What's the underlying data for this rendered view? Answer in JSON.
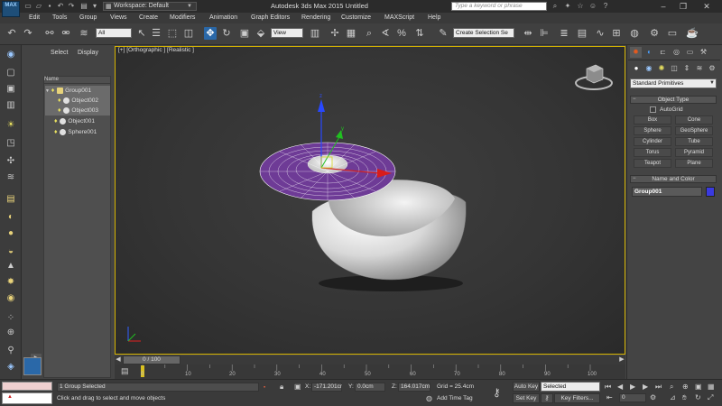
{
  "app": {
    "logo": "MAX",
    "window_title": "Autodesk 3ds Max 2015    Untitled",
    "workspace": "Workspace: Default",
    "search_placeholder": "Type a keyword or phrase"
  },
  "menu": [
    "Edit",
    "Tools",
    "Group",
    "Views",
    "Create",
    "Modifiers",
    "Animation",
    "Graph Editors",
    "Rendering",
    "Customize",
    "MAXScript",
    "Help"
  ],
  "toolbar": {
    "selection_filter": "All",
    "ref_coord": "View",
    "named_selection": "Create Selection Se"
  },
  "scene_explorer": {
    "tabs": [
      "Select",
      "Display"
    ],
    "column_header": "Name",
    "items": [
      {
        "name": "Group001",
        "level": 0,
        "selected": true
      },
      {
        "name": "Object002",
        "level": 1,
        "selected": true
      },
      {
        "name": "Object003",
        "level": 1,
        "selected": true
      },
      {
        "name": "Object001",
        "level": 0,
        "selected": false
      },
      {
        "name": "Sphere001",
        "level": 0,
        "selected": false
      }
    ]
  },
  "viewport": {
    "label": "[+] [Orthographic ] [Realistic ]"
  },
  "command_panel": {
    "category": "Standard Primitives",
    "object_type_title": "Object Type",
    "autogrid": "AutoGrid",
    "primitives": [
      "Box",
      "Cone",
      "Sphere",
      "GeoSphere",
      "Cylinder",
      "Tube",
      "Torus",
      "Pyramid",
      "Teapot",
      "Plane"
    ],
    "name_color_title": "Name and Color",
    "object_name": "Group001",
    "object_color": "#3a3ae0"
  },
  "timeline": {
    "frame_display": "0 / 100",
    "ticks": [
      "0",
      "10",
      "20",
      "30",
      "40",
      "50",
      "60",
      "70",
      "80",
      "90",
      "100"
    ]
  },
  "status": {
    "selection": "1 Group Selected",
    "prompt": "Click and drag to select and move objects",
    "x_label": "X:",
    "x_value": "-171.201cr",
    "y_label": "Y:",
    "y_value": "0.0cm",
    "z_label": "Z:",
    "z_value": "164.017cm",
    "grid": "Grid = 25.4cm",
    "add_time_tag": "Add Time Tag",
    "auto_key": "Auto Key",
    "set_key": "Set Key",
    "key_mode": "Selected",
    "key_filters": "Key Filters...",
    "frame": "0"
  },
  "colors": {
    "accent": "#2a68a8",
    "viewport_border": "#d6b400",
    "selection_highlight": "#6b6b6b"
  }
}
